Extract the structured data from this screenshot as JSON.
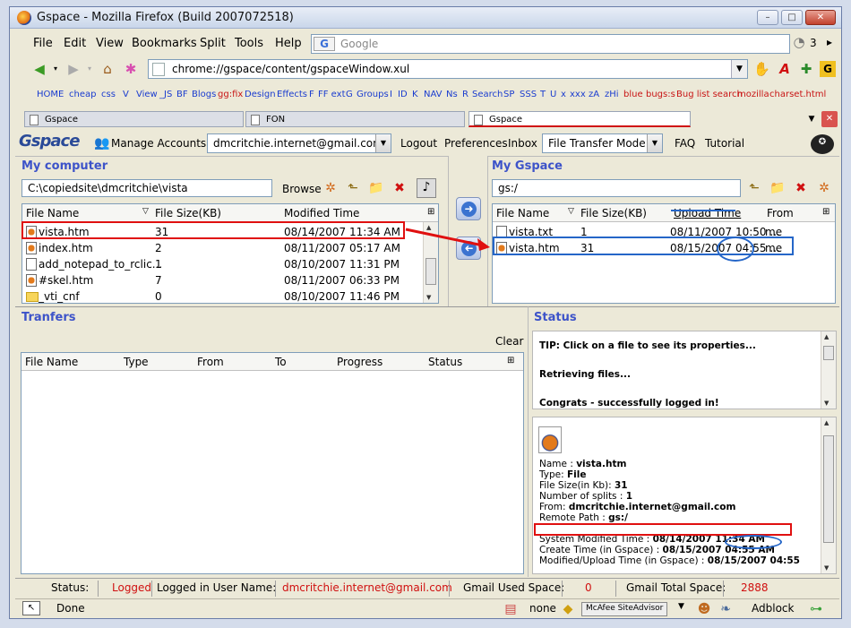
{
  "window": {
    "title": "Gspace - Mozilla Firefox (Build 2007072518)"
  },
  "menu": {
    "file": "File",
    "edit": "Edit",
    "view": "View",
    "bookmarks": "Bookmarks",
    "split": "Split",
    "tools": "Tools",
    "help": "Help"
  },
  "search": {
    "engine_icon": "G",
    "placeholder": "Google",
    "count": "3"
  },
  "nav": {
    "url": "chrome://gspace/content/gspaceWindow.xul"
  },
  "links": [
    "HOME",
    "cheap",
    "css",
    "V",
    "View",
    "_JS",
    "BF",
    "Blogs",
    "gg:fix",
    "Design",
    "Effects",
    "F",
    "FF ext",
    "G",
    "Groups",
    "I",
    "ID",
    "K",
    "NAV",
    "Ns",
    "R",
    "Search",
    "SP",
    "SSS",
    "T",
    "U",
    "x",
    "xxx",
    "zA",
    "zHi",
    "blue",
    "bugs:s",
    "Bug list search",
    "mozilla",
    "charset.html"
  ],
  "tabs": [
    "Gspace",
    "FON",
    "Gspace"
  ],
  "app": {
    "logo": "Gspace",
    "manage_accounts": "Manage Accounts",
    "account": "dmcritchie.internet@gmail.com",
    "logout": "Logout",
    "preferences": "Preferences",
    "inbox": "Inbox",
    "mode": "File Transfer Mode",
    "faq": "FAQ",
    "tutorial": "Tutorial"
  },
  "my_computer": {
    "title": "My computer",
    "path": "C:\\copiedsite\\dmcritchie\\vista",
    "browse": "Browse",
    "columns": [
      "File Name",
      "File Size(KB)",
      "Modified Time"
    ],
    "rows": [
      {
        "name": "vista.htm",
        "size": "31",
        "time": "08/14/2007 11:34 AM"
      },
      {
        "name": "index.htm",
        "size": "2",
        "time": "08/11/2007 05:17 AM"
      },
      {
        "name": "add_notepad_to_rclic...",
        "size": "1",
        "time": "08/10/2007 11:31 PM"
      },
      {
        "name": "#skel.htm",
        "size": "7",
        "time": "08/11/2007 06:33 PM"
      },
      {
        "name": "_vti_cnf",
        "size": "0",
        "time": "08/10/2007 11:46 PM"
      }
    ]
  },
  "my_gspace": {
    "title": "My Gspace",
    "path": "gs:/",
    "columns": [
      "File Name",
      "File Size(KB)",
      "Upload Time",
      "From"
    ],
    "rows": [
      {
        "name": "vista.txt",
        "size": "1",
        "time": "08/11/2007 10:50 ...",
        "from": "me"
      },
      {
        "name": "vista.htm",
        "size": "31",
        "time": "08/15/2007 04:55 ...",
        "from": "me"
      }
    ]
  },
  "transfers": {
    "title": "Tranfers",
    "clear": "Clear",
    "columns": [
      "File Name",
      "Type",
      "From",
      "To",
      "Progress",
      "Status"
    ]
  },
  "status_pane": {
    "title": "Status",
    "messages": [
      "TIP: Click on a file to see its properties...",
      "Retrieving files...",
      "Congrats - successfully logged in!"
    ],
    "details": [
      {
        "label": "Name :",
        "value": "vista.htm"
      },
      {
        "label": "Type:",
        "value": "File"
      },
      {
        "label": "File Size(in Kb):",
        "value": "31"
      },
      {
        "label": "Number of splits :",
        "value": "1"
      },
      {
        "label": "From:",
        "value": "dmcritchie.internet@gmail.com"
      },
      {
        "label": "Remote Path :",
        "value": "gs:/"
      }
    ],
    "times": [
      {
        "label": "System Modified Time :",
        "value": "08/14/2007 11:34 AM"
      },
      {
        "label": "Create Time (in Gspace) :",
        "value": "08/15/2007 04:55 AM"
      },
      {
        "label": "Modified/Upload Time (in Gspace) :",
        "value": "08/15/2007 04:55"
      }
    ]
  },
  "statusbar": {
    "status_label": "Status:",
    "status_value": "Logged",
    "user_label": "Logged in User Name:",
    "user_value": "dmcritchie.internet@gmail.com",
    "used_label": "Gmail Used Space:",
    "used_value": "0",
    "total_label": "Gmail Total Space:",
    "total_value": "2888"
  },
  "ffstatus": {
    "done": "Done",
    "none": "none",
    "siteadvisor": "McAfee SiteAdvisor",
    "adblock": "Adblock"
  },
  "colors": {
    "accent": "#3d53c9",
    "annotation_red": "#e01010",
    "annotation_blue": "#2566c8",
    "logged_red": "#d01010"
  }
}
